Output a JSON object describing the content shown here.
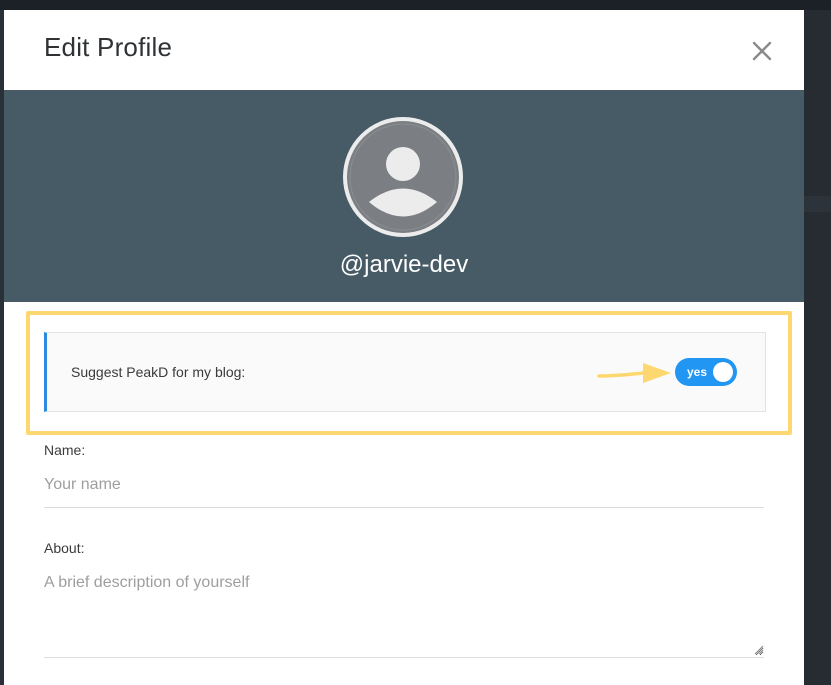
{
  "modal": {
    "title": "Edit Profile",
    "close_icon": "close-icon"
  },
  "cover": {
    "username": "@jarvie-dev",
    "avatar_icon": "default-avatar-icon"
  },
  "suggest": {
    "label": "Suggest PeakD for my blog:",
    "toggle_label": "yes",
    "toggle_on": true,
    "annotation_icon": "arrow-right-icon"
  },
  "form": {
    "name_label": "Name:",
    "name_placeholder": "Your name",
    "name_value": "",
    "about_label": "About:",
    "about_placeholder": "A brief description of yourself",
    "about_value": ""
  },
  "colors": {
    "cover": "#475b66",
    "highlight": "#fdd870",
    "accent_blue": "#2196f3",
    "panel_border_left": "#2d8ce0"
  }
}
